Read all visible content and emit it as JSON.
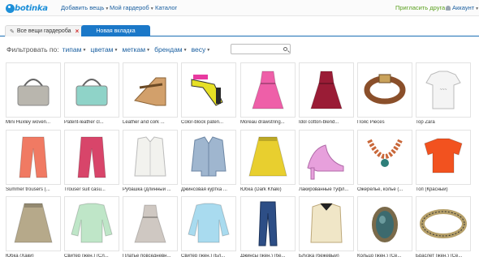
{
  "brand": {
    "logo_text": "botinka"
  },
  "top_nav": {
    "add_items": "Добавить вещь",
    "my_wardrobe": "Мой гардероб",
    "catalog": "Каталог",
    "invite_friend": "Пригласить друга",
    "account": "Аккаунт"
  },
  "tabs": {
    "all_items": "Все вещи гардероба",
    "close_symbol": "×",
    "new_tab": "Новая вкладка"
  },
  "filter": {
    "label": "Фильтровать по:",
    "options": [
      "типам",
      "цветам",
      "меткам",
      "брендам",
      "весу"
    ],
    "search_placeholder": ""
  },
  "items": [
    {
      "caption": "Mini Huxley woven...",
      "icon": "bag-icon",
      "color": "#b9b6ae"
    },
    {
      "caption": "Patent-leather cl...",
      "icon": "bag-icon",
      "color": "#8fd3c8"
    },
    {
      "caption": "Leather and cork ...",
      "icon": "wedge-sandal-icon",
      "color": "#d2a06b"
    },
    {
      "caption": "Color-block paten...",
      "icon": "platform-heel-icon",
      "color": "#e6e025"
    },
    {
      "caption": "Moreau drawstring...",
      "icon": "dress-icon",
      "color": "#ee5fa8"
    },
    {
      "caption": "Idol cotton-blend...",
      "icon": "dress-icon",
      "color": "#9a1c36"
    },
    {
      "caption": "Пояс Pieces",
      "icon": "belt-icon",
      "color": "#8a4f2a"
    },
    {
      "caption": "Top Zara",
      "icon": "t-shirt-icon",
      "color": "#f4f4f4"
    },
    {
      "caption": "Summer trousers (...",
      "icon": "trousers-icon",
      "color": "#f07a63"
    },
    {
      "caption": "Trouser suit casu...",
      "icon": "trousers-icon",
      "color": "#d8456a"
    },
    {
      "caption": "Рубашка (длинный ...",
      "icon": "shirt-icon",
      "color": "#f2f2ee"
    },
    {
      "caption": "Джинсовая куртка ...",
      "icon": "jacket-icon",
      "color": "#9fb6cf"
    },
    {
      "caption": "Юбка (Dark Khaki)",
      "icon": "skirt-icon",
      "color": "#e8cf2f"
    },
    {
      "caption": "Лакированные туфл...",
      "icon": "high-heel-icon",
      "color": "#e7a0dc"
    },
    {
      "caption": "Ожерелье, колье (...",
      "icon": "necklace-icon",
      "color": "#c9683a"
    },
    {
      "caption": "Топ (Красный)",
      "icon": "top-icon",
      "color": "#f2521f"
    },
    {
      "caption": "Юбка (Хаки)",
      "icon": "skirt-icon",
      "color": "#b6a98a"
    },
    {
      "caption": "Свитер (жен.) (Сл...",
      "icon": "sweater-icon",
      "color": "#bfe6c8"
    },
    {
      "caption": "Платье повседневн...",
      "icon": "dress-icon",
      "color": "#cfc8c2"
    },
    {
      "caption": "Свитер (жен.) (Бл...",
      "icon": "sweater-icon",
      "color": "#a9dbef"
    },
    {
      "caption": "Джинсы (жен.) (бе...",
      "icon": "jeans-icon",
      "color": "#2d4e86"
    },
    {
      "caption": "Блузка (бежевый)",
      "icon": "blouse-icon",
      "color": "#f0e6c7"
    },
    {
      "caption": "Кольцо (жен.) (Се...",
      "icon": "ring-icon",
      "color": "#3c6a6e"
    },
    {
      "caption": "Браслет (жен.) (Се...",
      "icon": "bracelet-icon",
      "color": "#b6a06a"
    }
  ]
}
